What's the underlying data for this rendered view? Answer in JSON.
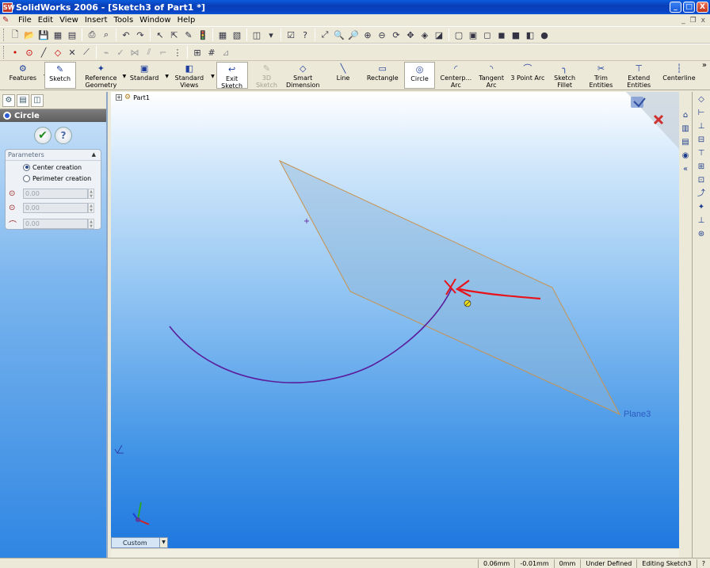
{
  "window": {
    "title": "SolidWorks 2006 - [Sketch3 of Part1 *]",
    "app_icon": "SW",
    "minimize": "_",
    "maximize": "□",
    "close": "X"
  },
  "menu": {
    "items": [
      "File",
      "Edit",
      "View",
      "Insert",
      "Tools",
      "Window",
      "Help"
    ],
    "mdi_minimize": "_",
    "mdi_restore": "❐",
    "mdi_close": "x"
  },
  "command_manager": {
    "buttons": [
      {
        "label": "Features",
        "icon": "features-icon",
        "glyph": "⚙",
        "dropdown": true
      },
      {
        "label": "Sketch",
        "icon": "sketch-icon",
        "glyph": "✎",
        "active": true
      },
      {
        "label": "Reference\nGeometry",
        "icon": "reference-geometry-icon",
        "glyph": "✦",
        "dropdown": true
      },
      {
        "label": "Standard",
        "icon": "standard-icon",
        "glyph": "▣",
        "dropdown": true
      },
      {
        "label": "Standard\nViews",
        "icon": "standard-views-icon",
        "glyph": "◧",
        "dropdown": true
      },
      {
        "label": "Exit Sketch",
        "icon": "exit-sketch-icon",
        "glyph": "↩",
        "active": true
      },
      {
        "label": "3D Sketch",
        "icon": "3d-sketch-icon",
        "glyph": "✎",
        "disabled": true
      },
      {
        "label": "Smart\nDimension",
        "icon": "smart-dimension-icon",
        "glyph": "◇"
      },
      {
        "label": "Line",
        "icon": "line-icon",
        "glyph": "╲"
      },
      {
        "label": "Rectangle",
        "icon": "rectangle-icon",
        "glyph": "▭"
      },
      {
        "label": "Circle",
        "icon": "circle-icon",
        "glyph": "◎",
        "active": true
      },
      {
        "label": "Centerp...\nArc",
        "icon": "centerpoint-arc-icon",
        "glyph": "◜"
      },
      {
        "label": "Tangent\nArc",
        "icon": "tangent-arc-icon",
        "glyph": "◝"
      },
      {
        "label": "3 Point Arc",
        "icon": "3-point-arc-icon",
        "glyph": "⌒"
      },
      {
        "label": "Sketch\nFillet",
        "icon": "sketch-fillet-icon",
        "glyph": "╮"
      },
      {
        "label": "Trim\nEntities",
        "icon": "trim-entities-icon",
        "glyph": "✂"
      },
      {
        "label": "Extend\nEntities",
        "icon": "extend-entities-icon",
        "glyph": "⊤"
      },
      {
        "label": "Centerline",
        "icon": "centerline-icon",
        "glyph": "┆"
      }
    ],
    "overflow": "»"
  },
  "property_manager": {
    "title": "Circle",
    "ok": "✔",
    "help": "?",
    "parameters_label": "Parameters",
    "collapse": "▲",
    "options": [
      {
        "label": "Center creation",
        "selected": true
      },
      {
        "label": "Perimeter creation",
        "selected": false
      }
    ],
    "fields": [
      {
        "icon": "center-x-icon",
        "glyph": "⊙",
        "value": "0.00"
      },
      {
        "icon": "center-y-icon",
        "glyph": "⊙",
        "value": "0.00"
      },
      {
        "icon": "radius-icon",
        "glyph": "⌒",
        "value": "0.00"
      }
    ]
  },
  "graphics": {
    "tree_root": "Part1",
    "plane_label": "Plane3"
  },
  "view_selector": {
    "value": "Custom"
  },
  "status_bar": {
    "x": "0.06mm",
    "y": "-0.01mm",
    "z": "0mm",
    "state": "Under Defined",
    "mode": "Editing Sketch3",
    "help": "?"
  },
  "colors": {
    "sketch_arc": "#5a1e9c",
    "plane_edge": "#c8924e",
    "plane_fill": "#8fb6d8",
    "annotation_arrow": "#e8121a",
    "plane_label": "#2c5bc0"
  }
}
